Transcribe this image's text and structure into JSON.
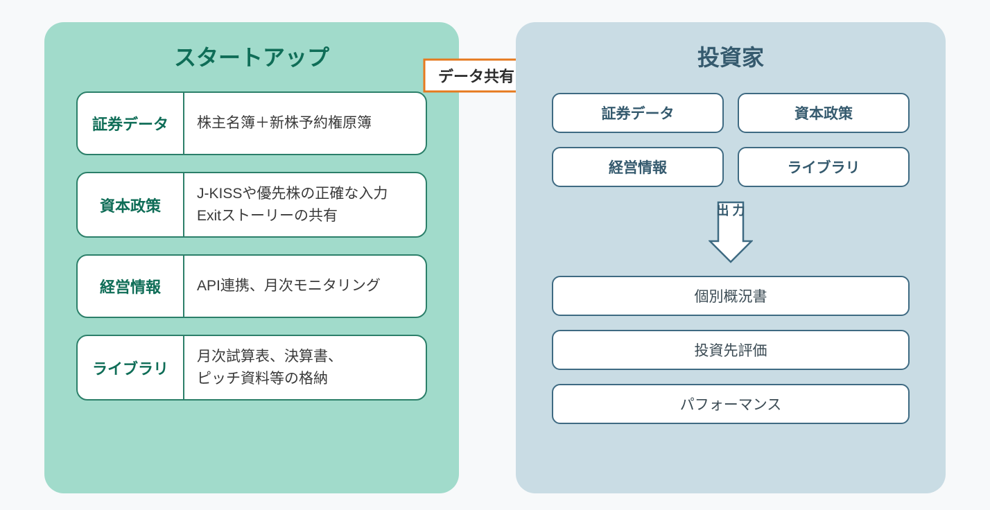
{
  "share_arrow_label": "データ共有",
  "left": {
    "title": "スタートアップ",
    "rows": [
      {
        "label": "証券データ",
        "desc": "株主名簿＋新株予約権原簿"
      },
      {
        "label": "資本政策",
        "desc": "J-KISSや優先株の正確な入力\nExitストーリーの共有"
      },
      {
        "label": "経営情報",
        "desc": "API連携、月次モニタリング"
      },
      {
        "label": "ライブラリ",
        "desc": "月次試算表、決算書、\nピッチ資料等の格納"
      }
    ]
  },
  "right": {
    "title": "投資家",
    "inputs": [
      "証券データ",
      "資本政策",
      "経営情報",
      "ライブラリ"
    ],
    "down_arrow_label": "出\n力",
    "outputs": [
      "個別概況書",
      "投資先評価",
      "パフォーマンス"
    ]
  },
  "colors": {
    "left_bg": "#a1dbcb",
    "left_accent": "#0f6d57",
    "right_bg": "#c9dce4",
    "right_accent": "#355a6e",
    "arrow_stroke": "#e67a1f"
  }
}
